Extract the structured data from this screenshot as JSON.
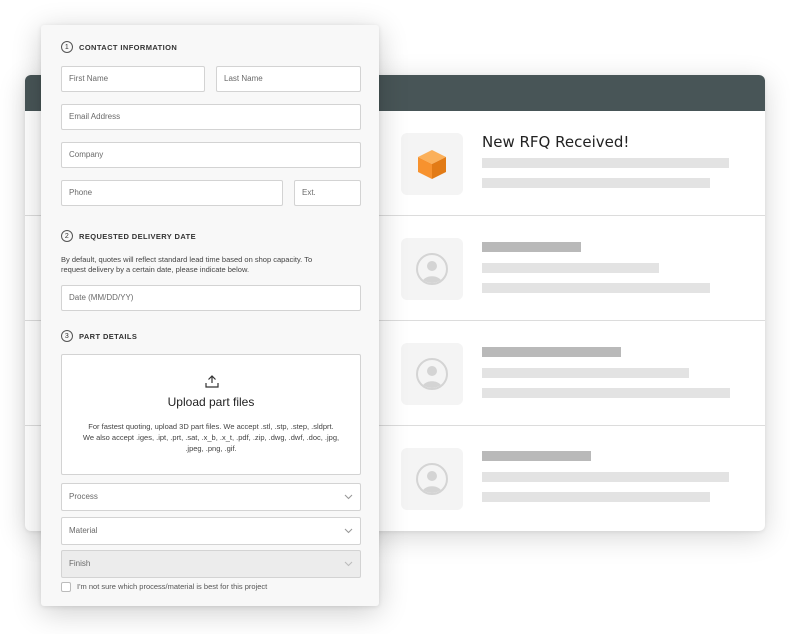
{
  "feed": {
    "rows": [
      {
        "title": "New RFQ Received!",
        "icon": "box-icon"
      },
      {
        "title": "",
        "icon": "user-avatar-icon"
      },
      {
        "title": "",
        "icon": "user-avatar-icon"
      },
      {
        "title": "",
        "icon": "user-avatar-icon"
      }
    ]
  },
  "form": {
    "contact": {
      "number": "1",
      "heading": "CONTACT INFORMATION",
      "first_name_placeholder": "First Name",
      "last_name_placeholder": "Last Name",
      "email_placeholder": "Email Address",
      "company_placeholder": "Company",
      "phone_placeholder": "Phone",
      "ext_placeholder": "Ext."
    },
    "delivery": {
      "number": "2",
      "heading": "REQUESTED DELIVERY DATE",
      "description_line1": "By default, quotes will reflect standard lead time based on shop capacity. To",
      "description_line2": "request delivery by a certain date, please indicate below.",
      "date_placeholder": "Date (MM/DD/YY)"
    },
    "parts": {
      "number": "3",
      "heading": "PART DETAILS",
      "upload_title": "Upload part files",
      "upload_desc_line1": "For fastest quoting, upload 3D part files. We accept .stl, .stp, .step, .sldprt.",
      "upload_desc_line2": "We also accept .iges, .ipt, .prt, .sat, .x_b, .x_t, .pdf, .zip, .dwg, .dwf, .doc, .jpg,",
      "upload_desc_line3": ".jpeg, .png, .gif.",
      "process_label": "Process",
      "material_label": "Material",
      "finish_label": "Finish",
      "unsure_label": "I'm not sure which process/material is best for this project"
    }
  },
  "colors": {
    "header": "#485557",
    "accent_orange": "#f7922e"
  }
}
